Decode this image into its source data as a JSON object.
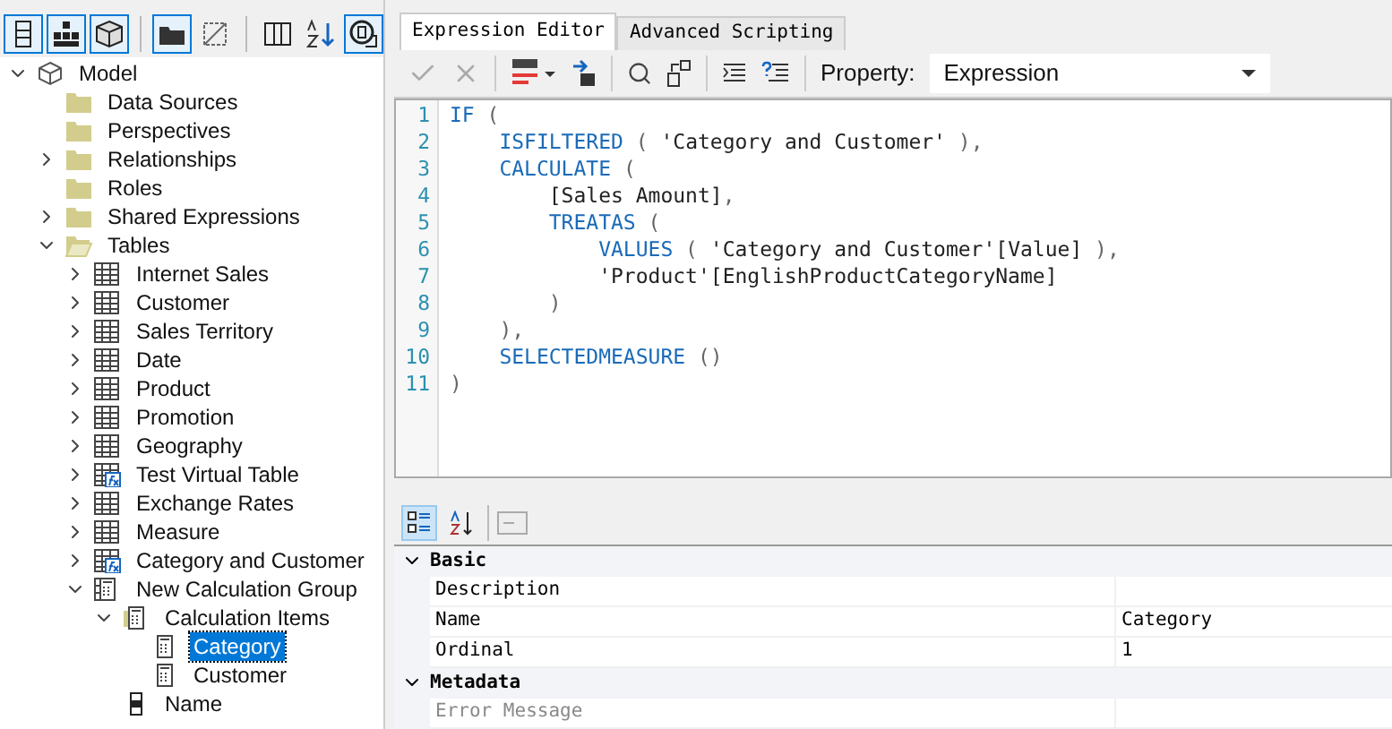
{
  "explorer": {
    "toolbar": [
      {
        "kind": "column",
        "pressed": true
      },
      {
        "kind": "hierarchy",
        "pressed": true
      },
      {
        "kind": "cube",
        "pressed": true
      },
      {
        "kind": "folder",
        "pressed": true
      },
      {
        "kind": "box",
        "pressed": false
      },
      {
        "kind": "columns",
        "pressed": false
      },
      {
        "kind": "sort",
        "pressed": false
      },
      {
        "kind": "frame",
        "pressed": true
      }
    ],
    "tree": [
      {
        "label": "Model",
        "kind": "model",
        "expanded": true,
        "selected": false,
        "children": [
          {
            "label": "Data Sources",
            "kind": "folder",
            "selected": false
          },
          {
            "label": "Perspectives",
            "kind": "folder",
            "selected": false
          },
          {
            "label": "Relationships",
            "kind": "folder",
            "expanded": false,
            "selected": false
          },
          {
            "label": "Roles",
            "kind": "folder",
            "selected": false
          },
          {
            "label": "Shared Expressions",
            "kind": "folder",
            "expanded": false,
            "selected": false
          },
          {
            "label": "Tables",
            "kind": "folder-open",
            "expanded": true,
            "selected": false,
            "children": [
              {
                "label": "Internet Sales",
                "kind": "table",
                "expanded": false,
                "selected": false
              },
              {
                "label": "Customer",
                "kind": "table",
                "expanded": false,
                "selected": false
              },
              {
                "label": "Sales Territory",
                "kind": "table",
                "expanded": false,
                "selected": false
              },
              {
                "label": "Date",
                "kind": "table",
                "expanded": false,
                "selected": false
              },
              {
                "label": "Product",
                "kind": "table",
                "expanded": false,
                "selected": false
              },
              {
                "label": "Promotion",
                "kind": "table",
                "expanded": false,
                "selected": false
              },
              {
                "label": "Geography",
                "kind": "table",
                "expanded": false,
                "selected": false
              },
              {
                "label": "Test Virtual Table",
                "kind": "calc-table",
                "expanded": false,
                "selected": false
              },
              {
                "label": "Exchange Rates",
                "kind": "table",
                "expanded": false,
                "selected": false
              },
              {
                "label": "Measure",
                "kind": "table",
                "expanded": false,
                "selected": false
              },
              {
                "label": "Category and Customer",
                "kind": "calc-table",
                "expanded": false,
                "selected": false
              },
              {
                "label": "New Calculation Group",
                "kind": "calc-group",
                "expanded": true,
                "selected": false,
                "children": [
                  {
                    "label": "Calculation Items",
                    "kind": "calc-folder",
                    "expanded": true,
                    "selected": false,
                    "children": [
                      {
                        "label": "Category",
                        "kind": "calc-item",
                        "selected": true
                      },
                      {
                        "label": "Customer",
                        "kind": "calc-item",
                        "selected": false
                      }
                    ]
                  },
                  {
                    "label": "Name",
                    "kind": "column",
                    "selected": false
                  }
                ]
              }
            ]
          }
        ]
      }
    ]
  },
  "tabs": [
    {
      "label": "Expression Editor",
      "selected": true
    },
    {
      "label": "Advanced Scripting",
      "selected": false
    }
  ],
  "editor_toolbar": {
    "property_label": "Property:",
    "property_value": "Expression"
  },
  "code": [
    {
      "number": "1",
      "tokens": [
        {
          "kind": "keyword",
          "text": "IF"
        },
        {
          "kind": "punct",
          "text": " ("
        }
      ]
    },
    {
      "number": "2",
      "tokens": [
        {
          "kind": "keyword",
          "text": "    ISFILTERED"
        },
        {
          "kind": "punct",
          "text": " ( "
        },
        {
          "kind": "text",
          "text": "'Category and Customer'"
        },
        {
          "kind": "punct",
          "text": " ),"
        }
      ]
    },
    {
      "number": "3",
      "tokens": [
        {
          "kind": "keyword",
          "text": "    CALCULATE"
        },
        {
          "kind": "punct",
          "text": " ("
        }
      ]
    },
    {
      "number": "4",
      "tokens": [
        {
          "kind": "text",
          "text": "        [Sales Amount]"
        },
        {
          "kind": "punct",
          "text": ","
        }
      ]
    },
    {
      "number": "5",
      "tokens": [
        {
          "kind": "keyword",
          "text": "        TREATAS"
        },
        {
          "kind": "punct",
          "text": " ("
        }
      ]
    },
    {
      "number": "6",
      "tokens": [
        {
          "kind": "keyword",
          "text": "            VALUES"
        },
        {
          "kind": "punct",
          "text": " ( "
        },
        {
          "kind": "text",
          "text": "'Category and Customer'[Value]"
        },
        {
          "kind": "punct",
          "text": " ),"
        }
      ]
    },
    {
      "number": "7",
      "tokens": [
        {
          "kind": "text",
          "text": "            'Product'[EnglishProductCategoryName]"
        }
      ]
    },
    {
      "number": "8",
      "tokens": [
        {
          "kind": "punct",
          "text": "        )"
        }
      ]
    },
    {
      "number": "9",
      "tokens": [
        {
          "kind": "punct",
          "text": "    ),"
        }
      ]
    },
    {
      "number": "10",
      "tokens": [
        {
          "kind": "keyword",
          "text": "    SELECTEDMEASURE"
        },
        {
          "kind": "punct",
          "text": " ()"
        }
      ]
    },
    {
      "number": "11",
      "tokens": [
        {
          "kind": "punct",
          "text": ")"
        }
      ]
    }
  ],
  "properties": {
    "categorized_selected": true,
    "sort_selected": false,
    "groups": [
      {
        "title": "Basic",
        "expanded": true,
        "rows": [
          {
            "name": "Description",
            "disabled": false
          },
          {
            "name": "Name",
            "value": "Category",
            "disabled": false
          },
          {
            "name": "Ordinal",
            "value": "1",
            "disabled": false
          }
        ]
      },
      {
        "title": "Metadata",
        "expanded": true,
        "rows": [
          {
            "name": "Error Message",
            "disabled": true
          }
        ]
      }
    ]
  }
}
